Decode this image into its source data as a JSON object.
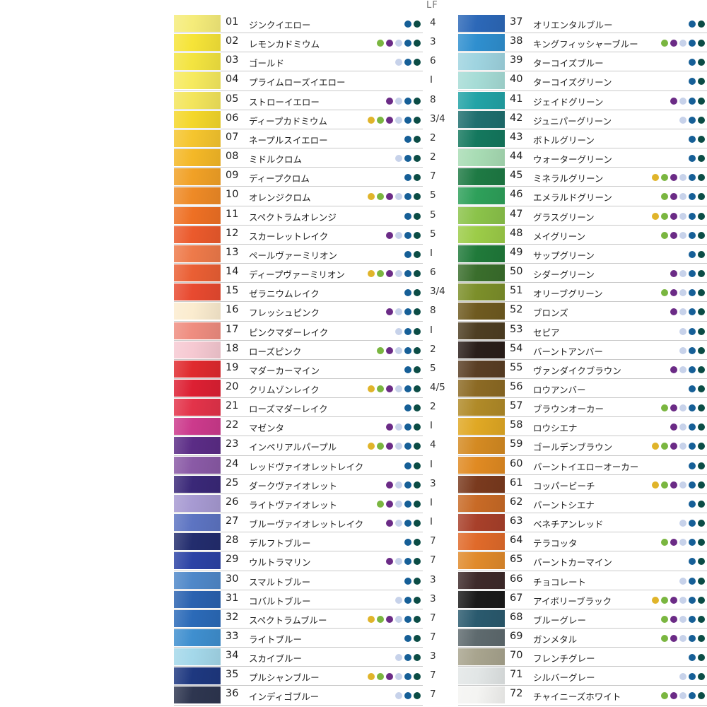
{
  "header": {
    "lf_label": "LF"
  },
  "colors": {
    "dot_yellow": "#e0b42a",
    "dot_green": "#7ab640",
    "dot_purple": "#6b2b86",
    "dot_pale": "#c7d2ea",
    "dot_blue": "#165f97",
    "dot_dark": "#0b4c45"
  },
  "left_items": [
    {
      "num": "01",
      "name": "ジンクイエロー",
      "color": "#f5ec7a",
      "dots": [
        "blue",
        "dark"
      ],
      "lf": "4"
    },
    {
      "num": "02",
      "name": "レモンカドミウム",
      "color": "#f6e438",
      "dots": [
        "green",
        "purple",
        "pale",
        "blue",
        "dark"
      ],
      "lf": "3"
    },
    {
      "num": "03",
      "name": "ゴールド",
      "color": "#f3e440",
      "dots": [
        "pale",
        "blue",
        "dark"
      ],
      "lf": "6"
    },
    {
      "num": "04",
      "name": "プライムローズイエロー",
      "color": "#f6ea5e",
      "dots": [],
      "lf": "I"
    },
    {
      "num": "05",
      "name": "ストローイエロー",
      "color": "#f3e55c",
      "dots": [
        "purple",
        "pale",
        "blue",
        "dark"
      ],
      "lf": "8"
    },
    {
      "num": "06",
      "name": "ディープカドミウム",
      "color": "#f4d72a",
      "dots": [
        "yellow",
        "green",
        "purple",
        "pale",
        "blue",
        "dark"
      ],
      "lf": "3/4"
    },
    {
      "num": "07",
      "name": "ネープルスイエロー",
      "color": "#f5c52e",
      "dots": [
        "blue",
        "dark"
      ],
      "lf": "2"
    },
    {
      "num": "08",
      "name": "ミドルクロム",
      "color": "#f4b827",
      "dots": [
        "pale",
        "blue",
        "dark"
      ],
      "lf": "2"
    },
    {
      "num": "09",
      "name": "ディープクロム",
      "color": "#f1a126",
      "dots": [
        "blue",
        "dark"
      ],
      "lf": "7"
    },
    {
      "num": "10",
      "name": "オレンジクロム",
      "color": "#ee8a26",
      "dots": [
        "yellow",
        "green",
        "purple",
        "pale",
        "blue",
        "dark"
      ],
      "lf": "5"
    },
    {
      "num": "11",
      "name": "スペクトラムオレンジ",
      "color": "#ee7024",
      "dots": [
        "blue",
        "dark"
      ],
      "lf": "5"
    },
    {
      "num": "12",
      "name": "スカーレットレイク",
      "color": "#eb5a2c",
      "dots": [
        "purple",
        "pale",
        "blue",
        "dark"
      ],
      "lf": "5"
    },
    {
      "num": "13",
      "name": "ペールヴァーミリオン",
      "color": "#ee7a4a",
      "dots": [
        "blue",
        "dark"
      ],
      "lf": "I"
    },
    {
      "num": "14",
      "name": "ディープヴァーミリオン",
      "color": "#ea5f34",
      "dots": [
        "yellow",
        "green",
        "purple",
        "pale",
        "blue",
        "dark"
      ],
      "lf": "6"
    },
    {
      "num": "15",
      "name": "ゼラニウムレイク",
      "color": "#e84a30",
      "dots": [
        "blue",
        "dark"
      ],
      "lf": "3/4"
    },
    {
      "num": "16",
      "name": "フレッシュピンク",
      "color": "#fbeccf",
      "dots": [
        "purple",
        "pale",
        "blue",
        "dark"
      ],
      "lf": "8"
    },
    {
      "num": "17",
      "name": "ピンクマダーレイク",
      "color": "#ef8d80",
      "dots": [
        "pale",
        "blue",
        "dark"
      ],
      "lf": "I"
    },
    {
      "num": "18",
      "name": "ローズピンク",
      "color": "#f6c9d2",
      "dots": [
        "green",
        "purple",
        "pale",
        "blue",
        "dark"
      ],
      "lf": "2"
    },
    {
      "num": "19",
      "name": "マダーカーマイン",
      "color": "#e02a2e",
      "dots": [
        "blue",
        "dark"
      ],
      "lf": "5"
    },
    {
      "num": "20",
      "name": "クリムゾンレイク",
      "color": "#dd2033",
      "dots": [
        "yellow",
        "green",
        "purple",
        "pale",
        "blue",
        "dark"
      ],
      "lf": "4/5"
    },
    {
      "num": "21",
      "name": "ローズマダーレイク",
      "color": "#e3334a",
      "dots": [
        "blue",
        "dark"
      ],
      "lf": "2"
    },
    {
      "num": "22",
      "name": "マゼンタ",
      "color": "#cc3a8c",
      "dots": [
        "purple",
        "pale",
        "blue",
        "dark"
      ],
      "lf": "I"
    },
    {
      "num": "23",
      "name": "インペリアルパープル",
      "color": "#5b2c86",
      "dots": [
        "yellow",
        "green",
        "purple",
        "pale",
        "blue",
        "dark"
      ],
      "lf": "4"
    },
    {
      "num": "24",
      "name": "レッドヴァイオレットレイク",
      "color": "#8a5aa6",
      "dots": [
        "blue",
        "dark"
      ],
      "lf": "I"
    },
    {
      "num": "25",
      "name": "ダークヴァイオレット",
      "color": "#3a2878",
      "dots": [
        "purple",
        "pale",
        "blue",
        "dark"
      ],
      "lf": "3"
    },
    {
      "num": "26",
      "name": "ライトヴァイオレット",
      "color": "#a79ad2",
      "dots": [
        "green",
        "purple",
        "pale",
        "blue",
        "dark"
      ],
      "lf": "I"
    },
    {
      "num": "27",
      "name": "ブルーヴァイオレットレイク",
      "color": "#5d74c2",
      "dots": [
        "purple",
        "pale",
        "blue",
        "dark"
      ],
      "lf": "I"
    },
    {
      "num": "28",
      "name": "デルフトブルー",
      "color": "#232d6e",
      "dots": [
        "blue",
        "dark"
      ],
      "lf": "7"
    },
    {
      "num": "29",
      "name": "ウルトラマリン",
      "color": "#2c43a5",
      "dots": [
        "purple",
        "pale",
        "blue",
        "dark"
      ],
      "lf": "7"
    },
    {
      "num": "30",
      "name": "スマルトブルー",
      "color": "#4f88c9",
      "dots": [
        "blue",
        "dark"
      ],
      "lf": "3"
    },
    {
      "num": "31",
      "name": "コバルトブルー",
      "color": "#2a62b0",
      "dots": [
        "pale",
        "blue",
        "dark"
      ],
      "lf": "3"
    },
    {
      "num": "32",
      "name": "スペクトラムブルー",
      "color": "#2b6ab8",
      "dots": [
        "yellow",
        "green",
        "purple",
        "pale",
        "blue",
        "dark"
      ],
      "lf": "7"
    },
    {
      "num": "33",
      "name": "ライトブルー",
      "color": "#3f8fcf",
      "dots": [
        "blue",
        "dark"
      ],
      "lf": "7"
    },
    {
      "num": "34",
      "name": "スカイブルー",
      "color": "#a4d8ea",
      "dots": [
        "pale",
        "blue",
        "dark"
      ],
      "lf": "3"
    },
    {
      "num": "35",
      "name": "プルシャンブルー",
      "color": "#1e3880",
      "dots": [
        "yellow",
        "green",
        "purple",
        "pale",
        "blue",
        "dark"
      ],
      "lf": "7"
    },
    {
      "num": "36",
      "name": "インディゴブルー",
      "color": "#2e3650",
      "dots": [
        "pale",
        "blue",
        "dark"
      ],
      "lf": "7"
    }
  ],
  "right_items": [
    {
      "num": "37",
      "name": "オリエンタルブルー",
      "color": "#2c68b8",
      "dots": [
        "blue",
        "dark"
      ],
      "lf": ""
    },
    {
      "num": "38",
      "name": "キングフィッシャーブルー",
      "color": "#2f8fcf",
      "dots": [
        "green",
        "purple",
        "pale",
        "blue",
        "dark"
      ],
      "lf": ""
    },
    {
      "num": "39",
      "name": "ターコイズブルー",
      "color": "#9fd4e0",
      "dots": [
        "blue",
        "dark"
      ],
      "lf": ""
    },
    {
      "num": "40",
      "name": "ターコイズグリーン",
      "color": "#a6dcd6",
      "dots": [
        "blue",
        "dark"
      ],
      "lf": ""
    },
    {
      "num": "41",
      "name": "ジェイドグリーン",
      "color": "#22a3a6",
      "dots": [
        "purple",
        "pale",
        "blue",
        "dark"
      ],
      "lf": ""
    },
    {
      "num": "42",
      "name": "ジュニパーグリーン",
      "color": "#1f6f6f",
      "dots": [
        "pale",
        "blue",
        "dark"
      ],
      "lf": ""
    },
    {
      "num": "43",
      "name": "ボトルグリーン",
      "color": "#14785e",
      "dots": [
        "blue",
        "dark"
      ],
      "lf": ""
    },
    {
      "num": "44",
      "name": "ウォーターグリーン",
      "color": "#a8dcb4",
      "dots": [
        "blue",
        "dark"
      ],
      "lf": ""
    },
    {
      "num": "45",
      "name": "ミネラルグリーン",
      "color": "#1e7a44",
      "dots": [
        "yellow",
        "green",
        "purple",
        "pale",
        "blue",
        "dark"
      ],
      "lf": ""
    },
    {
      "num": "46",
      "name": "エメラルドグリーン",
      "color": "#2ea05a",
      "dots": [
        "green",
        "purple",
        "pale",
        "blue",
        "dark"
      ],
      "lf": ""
    },
    {
      "num": "47",
      "name": "グラスグリーン",
      "color": "#8bc34a",
      "dots": [
        "yellow",
        "green",
        "purple",
        "pale",
        "blue",
        "dark"
      ],
      "lf": ""
    },
    {
      "num": "48",
      "name": "メイグリーン",
      "color": "#9ccc48",
      "dots": [
        "green",
        "purple",
        "pale",
        "blue",
        "dark"
      ],
      "lf": ""
    },
    {
      "num": "49",
      "name": "サップグリーン",
      "color": "#207a3a",
      "dots": [
        "blue",
        "dark"
      ],
      "lf": ""
    },
    {
      "num": "50",
      "name": "シダーグリーン",
      "color": "#3a6e2c",
      "dots": [
        "purple",
        "pale",
        "blue",
        "dark"
      ],
      "lf": ""
    },
    {
      "num": "51",
      "name": "オリーブグリーン",
      "color": "#7c8f2a",
      "dots": [
        "green",
        "purple",
        "pale",
        "blue",
        "dark"
      ],
      "lf": ""
    },
    {
      "num": "52",
      "name": "ブロンズ",
      "color": "#6f5a20",
      "dots": [
        "purple",
        "pale",
        "blue",
        "dark"
      ],
      "lf": ""
    },
    {
      "num": "53",
      "name": "セピア",
      "color": "#4e3e22",
      "dots": [
        "pale",
        "blue",
        "dark"
      ],
      "lf": ""
    },
    {
      "num": "54",
      "name": "バーントアンバー",
      "color": "#2a1e1a",
      "dots": [
        "pale",
        "blue",
        "dark"
      ],
      "lf": ""
    },
    {
      "num": "55",
      "name": "ヴァンダイクブラウン",
      "color": "#5a3e24",
      "dots": [
        "purple",
        "pale",
        "blue",
        "dark"
      ],
      "lf": ""
    },
    {
      "num": "56",
      "name": "ロウアンバー",
      "color": "#8c6a24",
      "dots": [
        "blue",
        "dark"
      ],
      "lf": ""
    },
    {
      "num": "57",
      "name": "ブラウンオーカー",
      "color": "#b08a28",
      "dots": [
        "green",
        "purple",
        "pale",
        "blue",
        "dark"
      ],
      "lf": ""
    },
    {
      "num": "58",
      "name": "ロウシエナ",
      "color": "#e0a824",
      "dots": [
        "purple",
        "pale",
        "blue",
        "dark"
      ],
      "lf": ""
    },
    {
      "num": "59",
      "name": "ゴールデンブラウン",
      "color": "#d48a22",
      "dots": [
        "yellow",
        "green",
        "purple",
        "pale",
        "blue",
        "dark"
      ],
      "lf": ""
    },
    {
      "num": "60",
      "name": "バーントイエローオーカー",
      "color": "#e08a22",
      "dots": [
        "blue",
        "dark"
      ],
      "lf": ""
    },
    {
      "num": "61",
      "name": "コッパービーチ",
      "color": "#7a3a1e",
      "dots": [
        "yellow",
        "green",
        "purple",
        "pale",
        "blue",
        "dark"
      ],
      "lf": ""
    },
    {
      "num": "62",
      "name": "バーントシエナ",
      "color": "#c86a26",
      "dots": [
        "blue",
        "dark"
      ],
      "lf": ""
    },
    {
      "num": "63",
      "name": "ベネチアンレッド",
      "color": "#a8402a",
      "dots": [
        "pale",
        "blue",
        "dark"
      ],
      "lf": ""
    },
    {
      "num": "64",
      "name": "テラコッタ",
      "color": "#e06a2a",
      "dots": [
        "green",
        "purple",
        "pale",
        "blue",
        "dark"
      ],
      "lf": ""
    },
    {
      "num": "65",
      "name": "バーントカーマイン",
      "color": "#e08a2c",
      "dots": [
        "blue",
        "dark"
      ],
      "lf": ""
    },
    {
      "num": "66",
      "name": "チョコレート",
      "color": "#3e2a2a",
      "dots": [
        "pale",
        "blue",
        "dark"
      ],
      "lf": ""
    },
    {
      "num": "67",
      "name": "アイボリーブラック",
      "color": "#1a1a1a",
      "dots": [
        "yellow",
        "green",
        "purple",
        "pale",
        "blue",
        "dark"
      ],
      "lf": ""
    },
    {
      "num": "68",
      "name": "ブルーグレー",
      "color": "#2a5a6e",
      "dots": [
        "green",
        "purple",
        "pale",
        "blue",
        "dark"
      ],
      "lf": ""
    },
    {
      "num": "69",
      "name": "ガンメタル",
      "color": "#5e6a6e",
      "dots": [
        "green",
        "purple",
        "pale",
        "blue",
        "dark"
      ],
      "lf": ""
    },
    {
      "num": "70",
      "name": "フレンチグレー",
      "color": "#a8a48e",
      "dots": [
        "blue",
        "dark"
      ],
      "lf": ""
    },
    {
      "num": "71",
      "name": "シルバーグレー",
      "color": "#e2e6e6",
      "dots": [
        "pale",
        "blue",
        "dark"
      ],
      "lf": ""
    },
    {
      "num": "72",
      "name": "チャイニーズホワイト",
      "color": "#f4f4f2",
      "dots": [
        "green",
        "purple",
        "pale",
        "blue",
        "dark"
      ],
      "lf": ""
    }
  ]
}
